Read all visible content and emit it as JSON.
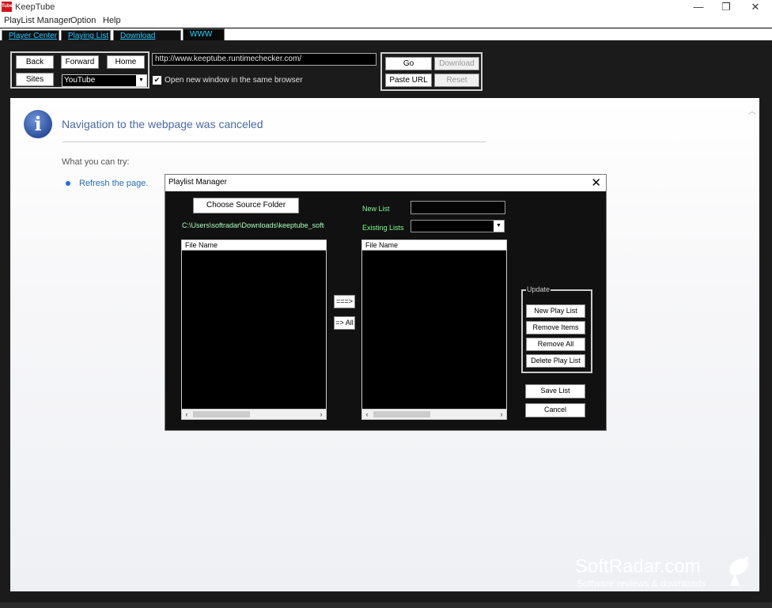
{
  "window": {
    "app_icon_text": "Tube",
    "title": "KeepTube",
    "minimize": "—",
    "restore": "❐",
    "close": "✕"
  },
  "menu": [
    "PlayList Manager",
    "Option",
    "Help"
  ],
  "tabs": [
    "Player Center",
    "Playing List",
    "Download Center",
    "WWW"
  ],
  "toolbar": {
    "back": "Back",
    "forward": "Forward",
    "home": "Home",
    "sites": "Sites",
    "site_select": "YouTube",
    "url": "http://www.keeptube.runtimechecker.com/",
    "open_new_window_label": "Open new window in the same browser",
    "open_new_window_checked": true,
    "go": "Go",
    "download": "Download",
    "paste_url": "Paste URL",
    "reset": "Reset"
  },
  "browser": {
    "title": "Navigation to the webpage was canceled",
    "try_label": "What you can try:",
    "refresh_link": "Refresh the page."
  },
  "dialog": {
    "title": "Playlist Manager",
    "choose_source": "Choose Source Folder",
    "source_path": "C:\\Users\\softradar\\Downloads\\keeptube_softr",
    "new_list_label": "New List",
    "existing_lists_label": "Existing Lists",
    "left_col_header": "File Name",
    "right_col_header": "File Name",
    "move_one": "===>",
    "move_all": "=> All",
    "update_legend": "Update",
    "new_play_list": "New Play List",
    "remove_items": "Remove Items",
    "remove_all": "Remove All",
    "delete_play_list": "Delete Play List",
    "save_list": "Save List",
    "cancel": "Cancel"
  },
  "watermark": {
    "brand": "SoftRadar.com",
    "tagline": "Software reviews & downloads"
  }
}
